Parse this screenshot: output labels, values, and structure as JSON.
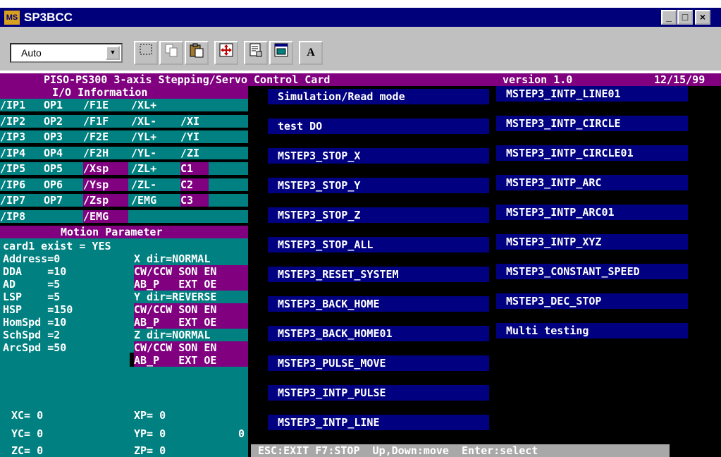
{
  "window": {
    "title": "SP3BCC",
    "icon_text": "MS"
  },
  "window_buttons": {
    "minimize": "_",
    "maximize": "□",
    "close": "×"
  },
  "toolbar": {
    "font_value": "Auto",
    "bold_font_label": "A"
  },
  "header": {
    "title": "PISO-PS300 3-axis Stepping/Servo Control Card",
    "version": "version 1.0",
    "date": "12/15/99"
  },
  "io": {
    "heading": "I/O Information",
    "rows": [
      [
        {
          "t": "/IP1",
          "on": false
        },
        {
          "t": "OP1",
          "on": false
        },
        {
          "t": "/F1E",
          "on": false
        },
        {
          "t": "/XL+",
          "on": false
        },
        {
          "t": "",
          "on": false
        }
      ],
      [
        {
          "t": "/IP2",
          "on": false
        },
        {
          "t": "OP2",
          "on": false
        },
        {
          "t": "/F1F",
          "on": false
        },
        {
          "t": "/XL-",
          "on": false
        },
        {
          "t": "/XI",
          "on": false
        }
      ],
      [
        {
          "t": "/IP3",
          "on": false
        },
        {
          "t": "OP3",
          "on": false
        },
        {
          "t": "/F2E",
          "on": false
        },
        {
          "t": "/YL+",
          "on": false
        },
        {
          "t": "/YI",
          "on": false
        }
      ],
      [
        {
          "t": "/IP4",
          "on": false
        },
        {
          "t": "OP4",
          "on": false
        },
        {
          "t": "/F2H",
          "on": false
        },
        {
          "t": "/YL-",
          "on": false
        },
        {
          "t": "/ZI",
          "on": false
        }
      ],
      [
        {
          "t": "/IP5",
          "on": false
        },
        {
          "t": "OP5",
          "on": false
        },
        {
          "t": "/Xsp",
          "on": true
        },
        {
          "t": "/ZL+",
          "on": false
        },
        {
          "t": "C1",
          "on": true
        }
      ],
      [
        {
          "t": "/IP6",
          "on": false
        },
        {
          "t": "OP6",
          "on": false
        },
        {
          "t": "/Ysp",
          "on": true
        },
        {
          "t": "/ZL-",
          "on": false
        },
        {
          "t": "C2",
          "on": true
        }
      ],
      [
        {
          "t": "/IP7",
          "on": false
        },
        {
          "t": "OP7",
          "on": false
        },
        {
          "t": "/Zsp",
          "on": true
        },
        {
          "t": "/EMG",
          "on": false
        },
        {
          "t": "C3",
          "on": true
        }
      ],
      [
        {
          "t": "/IP8",
          "on": false
        },
        {
          "t": "",
          "on": false
        },
        {
          "t": "/EMG",
          "on": true
        },
        {
          "t": "",
          "on": false
        },
        {
          "t": "",
          "on": false
        }
      ]
    ]
  },
  "motion": {
    "heading": "Motion Parameter",
    "card_exist": "card1 exist = YES",
    "params": [
      "Address=0",
      "DDA    =10",
      "AD     =5",
      "LSP    =5",
      "HSP    =150",
      "HomSpd =10",
      "SchSpd =2",
      "ArcSpd =50"
    ],
    "x_dir": "X dir=NORMAL",
    "y_dir": "Y dir=REVERSE",
    "z_dir": "Z dir=NORMAL",
    "mode_line1": "CW/CCW SON EN",
    "mode_line2": "AB_P   EXT OE",
    "positions": {
      "xc": "XC= 0",
      "yc": "YC= 0",
      "zc": "ZC= 0",
      "xp": "XP= 0",
      "yp": "YP= 0",
      "zp": "ZP= 0",
      "extra": "0"
    }
  },
  "menu": {
    "col1": [
      "Simulation/Read mode",
      "test DO",
      "MSTEP3_STOP_X",
      "MSTEP3_STOP_Y",
      "MSTEP3_STOP_Z",
      "MSTEP3_STOP_ALL",
      "MSTEP3_RESET_SYSTEM",
      "MSTEP3_BACK_HOME",
      "MSTEP3_BACK_HOME01",
      "MSTEP3_PULSE_MOVE",
      "MSTEP3_INTP_PULSE",
      "MSTEP3_INTP_LINE"
    ],
    "col2": [
      "MSTEP3_INTP_LINE01",
      "MSTEP3_INTP_CIRCLE",
      "MSTEP3_INTP_CIRCLE01",
      "MSTEP3_INTP_ARC",
      "MSTEP3_INTP_ARC01",
      "MSTEP3_INTP_XYZ",
      "MSTEP3_CONSTANT_SPEED",
      "MSTEP3_DEC_STOP",
      "Multi testing"
    ],
    "selected_index": 0
  },
  "status_bar": "ESC:EXIT F7:STOP  Up,Down:move  Enter:select",
  "colors": {
    "console_bg": "#000000",
    "teal": "#008080",
    "magenta": "#800080",
    "menu_blue": "#000080",
    "titlebar": "#00007b",
    "status_gray": "#a8a8a8"
  },
  "icons": [
    "ms-dos-icon",
    "select-icon",
    "copy-icon",
    "paste-icon",
    "fullscreen-icon",
    "properties-icon",
    "background-icon",
    "font-icon"
  ]
}
